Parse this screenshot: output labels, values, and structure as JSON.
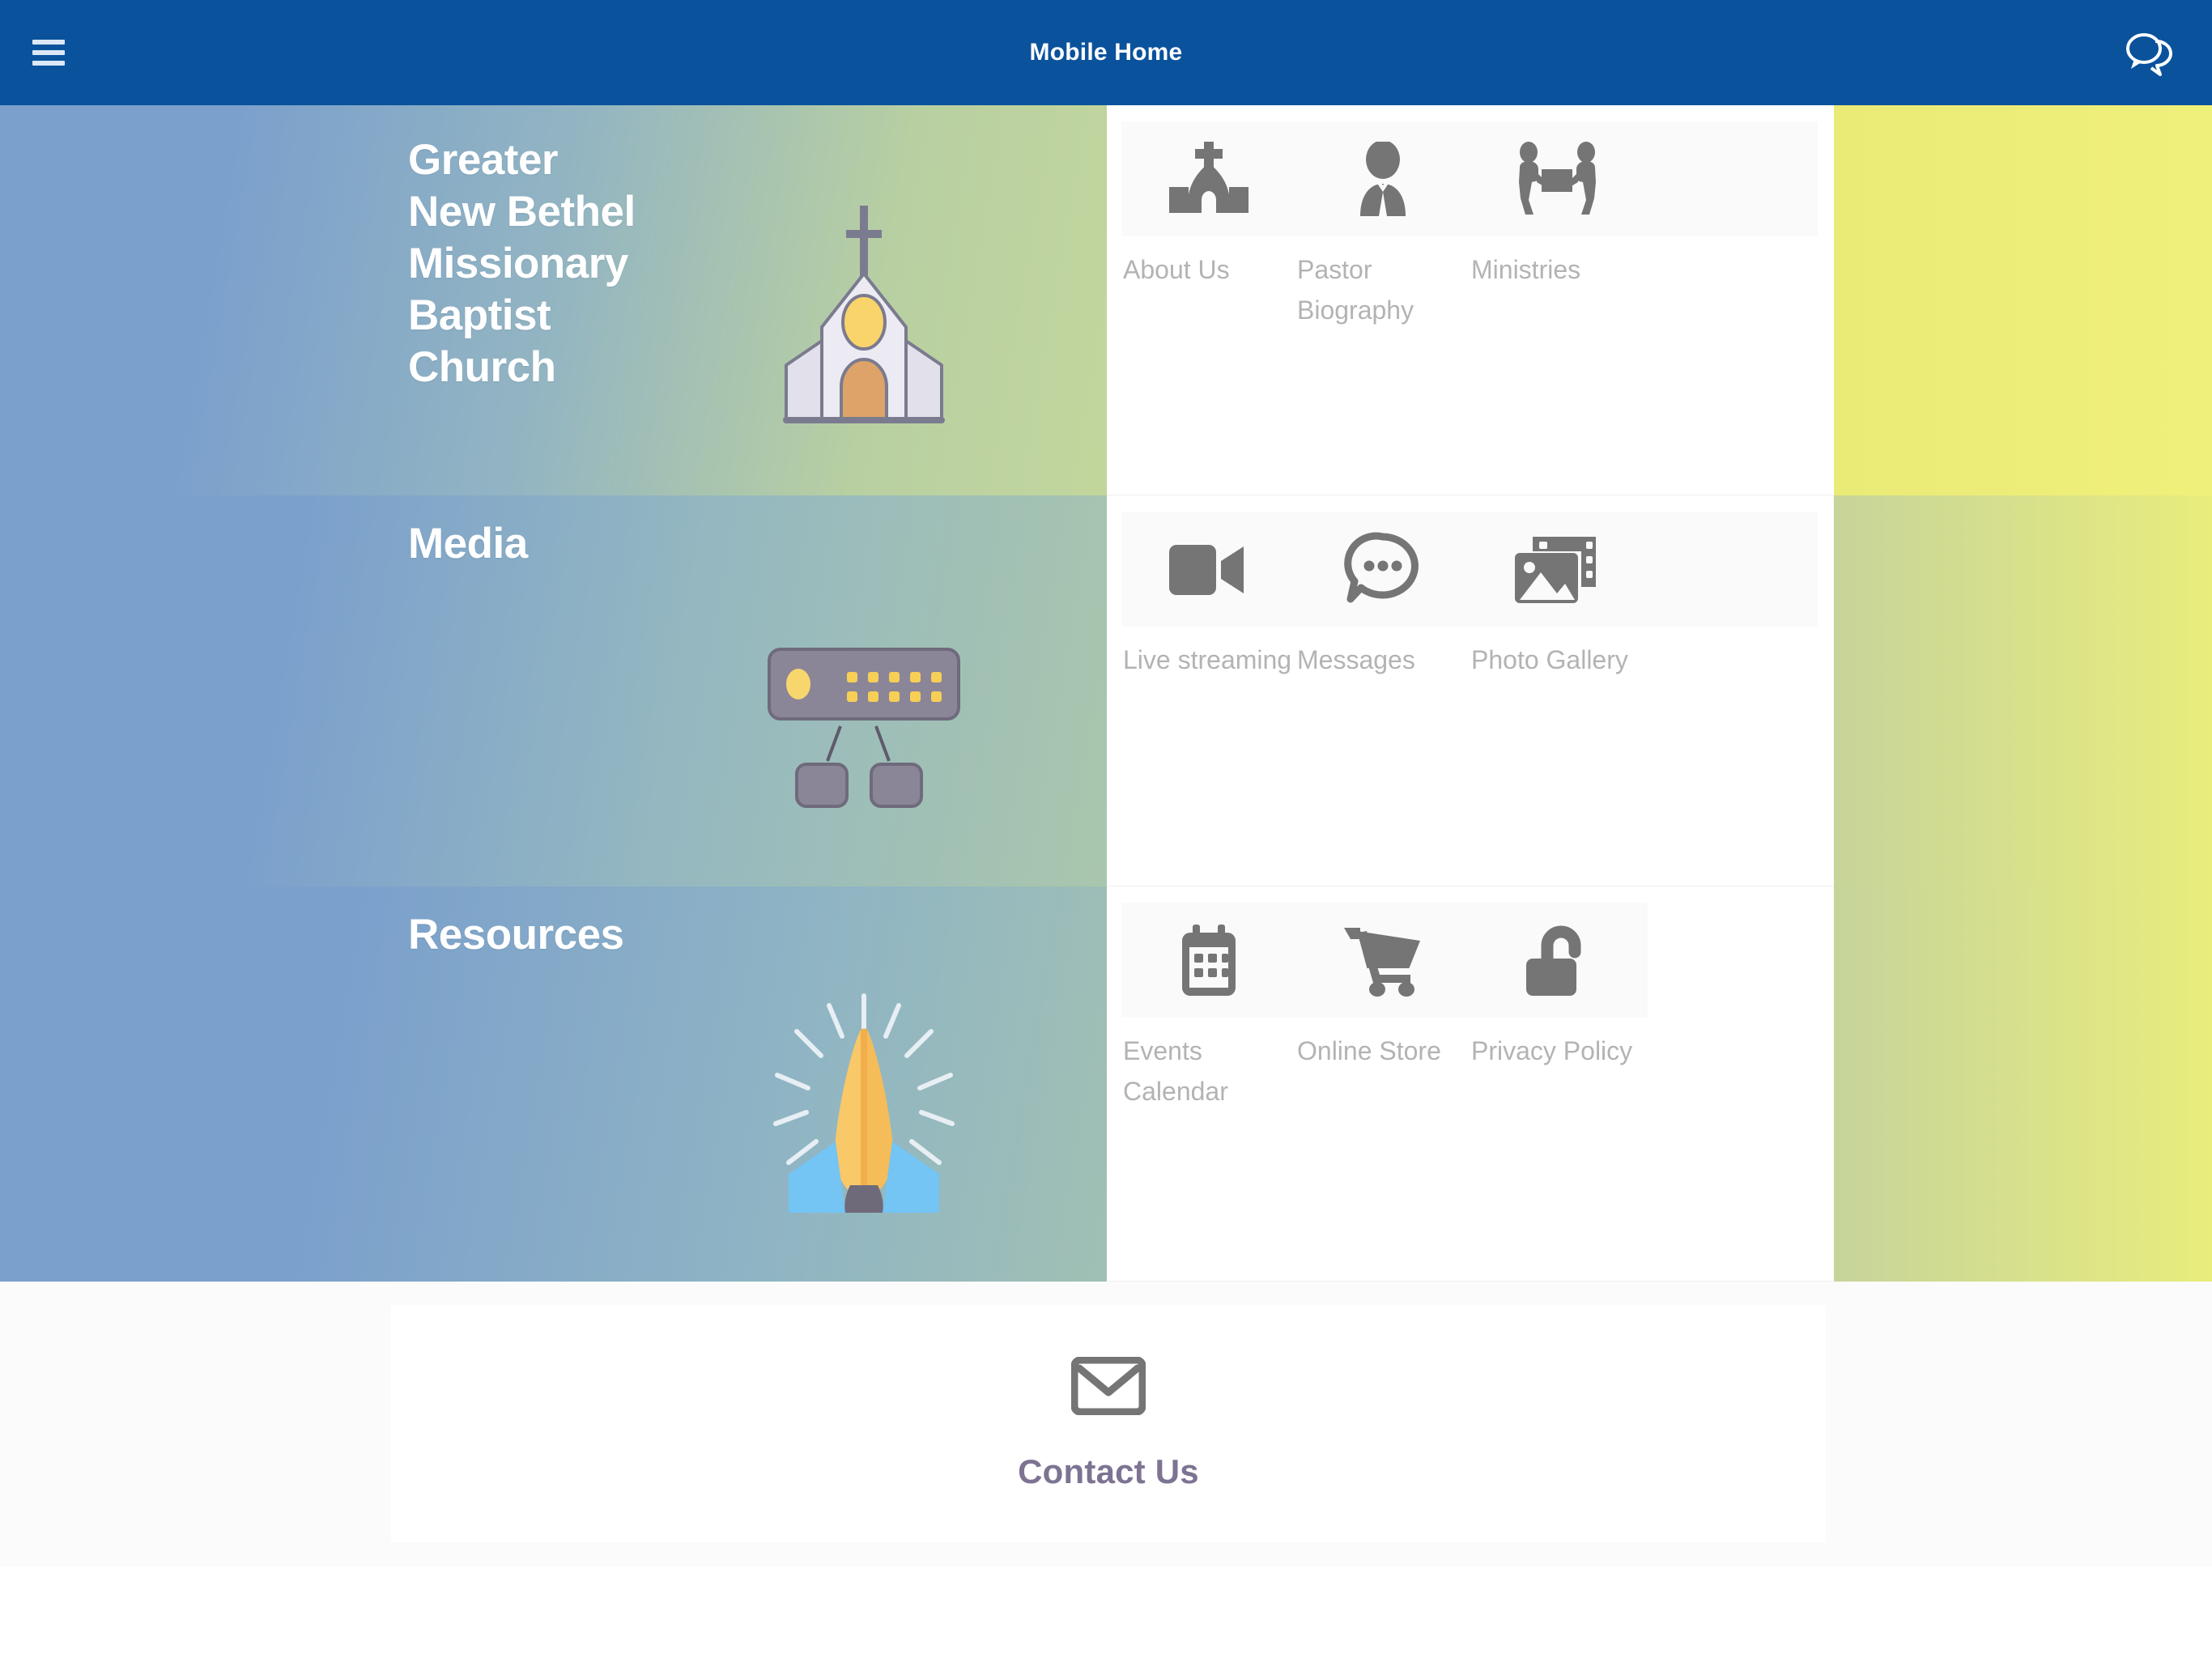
{
  "appbar": {
    "title": "Mobile Home",
    "menu_icon": "hamburger-menu-icon",
    "chat_icon": "chat-bubbles-icon"
  },
  "sections": [
    {
      "heading": "Greater\nNew Bethel\nMissionary\nBaptist\nChurch",
      "art_icon": "church-emoji",
      "tiles": [
        {
          "label": "About Us",
          "icon": "church-icon"
        },
        {
          "label": "Pastor Biography",
          "icon": "person-in-tie-icon"
        },
        {
          "label": "Ministries",
          "icon": "people-carrying-box-icon"
        }
      ]
    },
    {
      "heading": "Media",
      "art_icon": "control-knobs-emoji",
      "tiles": [
        {
          "label": "Live streaming",
          "icon": "video-camera-icon"
        },
        {
          "label": "Messages",
          "icon": "speech-bubble-icon"
        },
        {
          "label": "Photo Gallery",
          "icon": "photo-gallery-icon"
        }
      ]
    },
    {
      "heading": "Resources",
      "art_icon": "praying-hands-emoji",
      "tiles": [
        {
          "label": "Events Calendar",
          "icon": "calendar-icon"
        },
        {
          "label": "Online Store",
          "icon": "shopping-cart-icon"
        },
        {
          "label": "Privacy Policy",
          "icon": "open-padlock-icon"
        }
      ]
    }
  ],
  "contact": {
    "label": "Contact Us",
    "icon": "envelope-icon"
  },
  "colors": {
    "appbar_blue": "#0a529c",
    "banner_blue": "#7ba0cc",
    "banner_green": "#b8cfa2",
    "strip_yellow": "#eaeb77",
    "tile_label_gray": "#b3b3b3",
    "tile_icon_gray": "#757575",
    "contact_purple": "#7d7392"
  }
}
